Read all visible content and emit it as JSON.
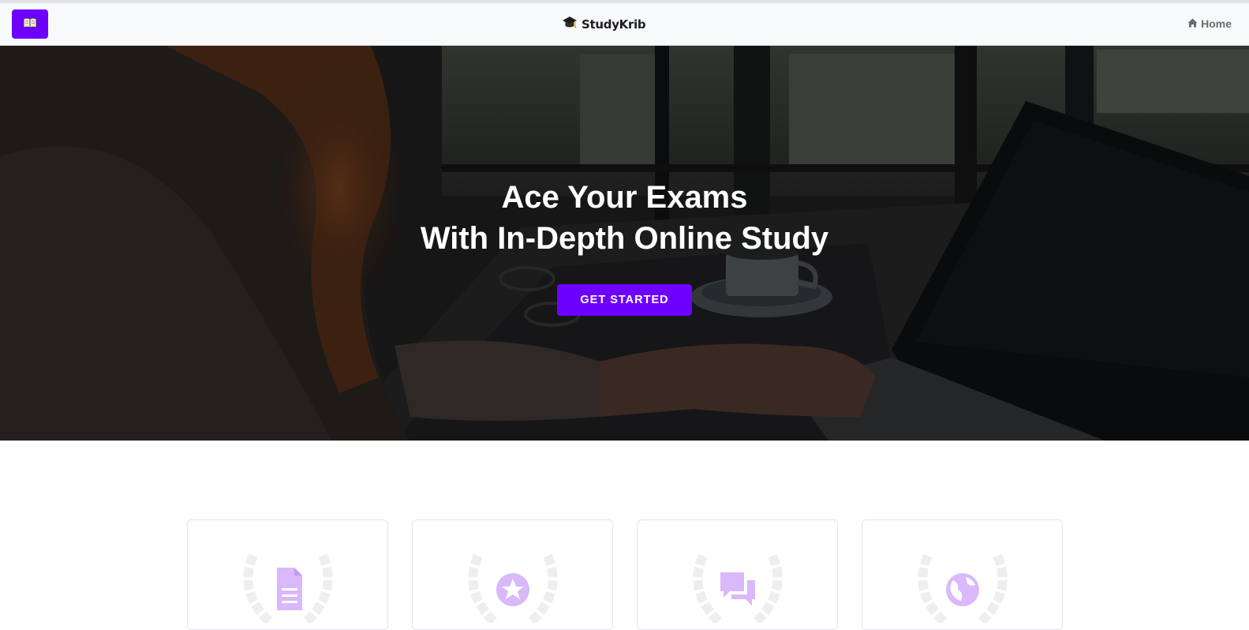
{
  "navbar": {
    "menu_icon": "open-book-icon",
    "brand_icon": "graduation-cap-icon",
    "brand_name": "StudyKrib",
    "home_icon": "home-icon",
    "home_label": "Home"
  },
  "hero": {
    "title_line1": "Ace Your Exams",
    "title_line2": "With In-Depth Online Study",
    "cta_label": "GET STARTED"
  },
  "features": {
    "cards": [
      {
        "icon": "document-icon"
      },
      {
        "icon": "star-badge-icon"
      },
      {
        "icon": "chat-bubbles-icon"
      },
      {
        "icon": "globe-icon"
      }
    ]
  },
  "colors": {
    "accent": "#6e00ff",
    "feature_icon": "#d9b8fb",
    "laurel": "#eeeeef",
    "navbar_bg": "#f8f9fa"
  }
}
